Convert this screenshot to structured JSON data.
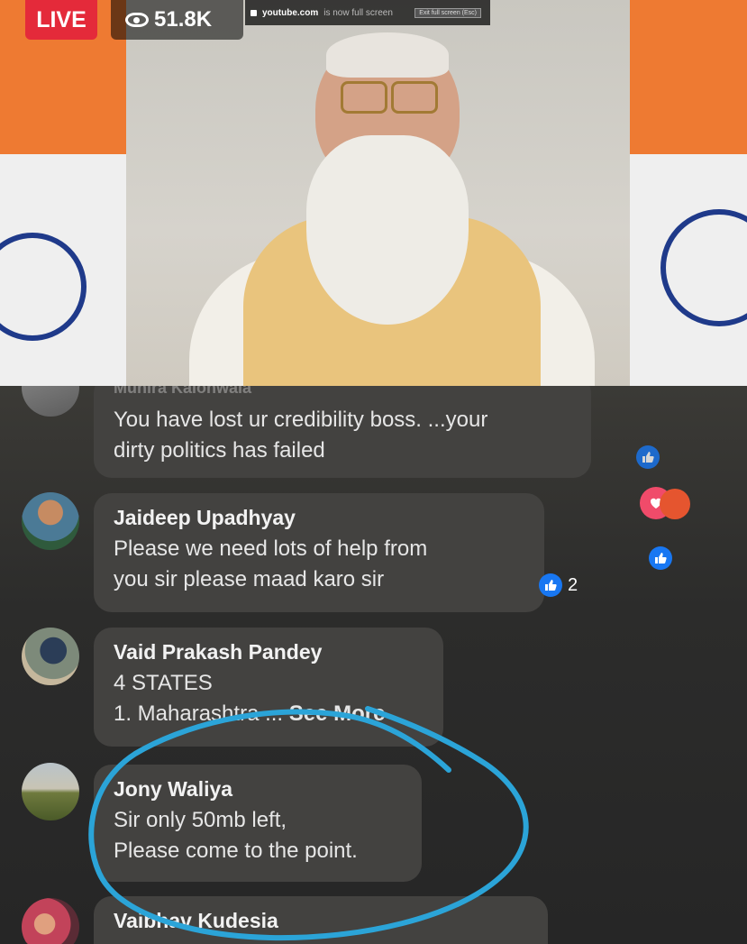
{
  "overlay": {
    "live_label": "LIVE",
    "viewer_count": "51.8K",
    "banner_domain": "youtube.com",
    "banner_text": "is now full screen",
    "banner_button": "Exit full screen (Esc)"
  },
  "chat": {
    "partial_name": "Munira Kalonwala",
    "partial_message_1": "You have lost ur credibility boss. ...your",
    "partial_message_2": "dirty politics has failed",
    "comments": [
      {
        "name": "Jaideep Upadhyay",
        "line1": "Please we need lots of help from",
        "line2": "you sir please maad karo sir",
        "likes": "2"
      },
      {
        "name": "Vaid Prakash Pandey",
        "line1": "4 STATES",
        "line2": "1. Maharashtra ...",
        "see_more": "See More"
      },
      {
        "name": "Jony Waliya",
        "line1": "Sir only 50mb left,",
        "line2": "Please come to the point."
      },
      {
        "name": "Vaibhav Kudesia"
      }
    ]
  },
  "colors": {
    "live": "#e42a3a",
    "like": "#1877f2",
    "annotation": "#2ba4d8"
  }
}
